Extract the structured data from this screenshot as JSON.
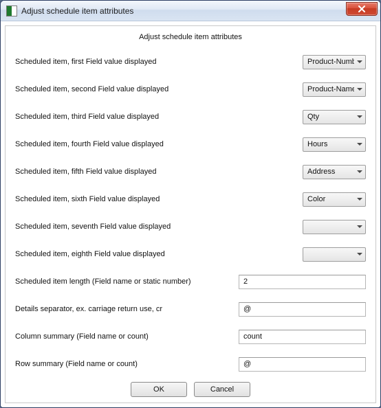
{
  "window": {
    "title": "Adjust schedule item attributes"
  },
  "form": {
    "heading": "Adjust schedule item attributes",
    "fields": {
      "f1": {
        "label": "Scheduled item, first Field value displayed",
        "value": "Product-Number"
      },
      "f2": {
        "label": "Scheduled item, second Field value displayed",
        "value": "Product-Name"
      },
      "f3": {
        "label": "Scheduled item, third Field value displayed",
        "value": "Qty"
      },
      "f4": {
        "label": "Scheduled item, fourth Field value displayed",
        "value": "Hours"
      },
      "f5": {
        "label": "Scheduled item, fifth Field value displayed",
        "value": "Address"
      },
      "f6": {
        "label": "Scheduled item, sixth Field value displayed",
        "value": "Color"
      },
      "f7": {
        "label": "Scheduled item, seventh Field value displayed",
        "value": ""
      },
      "f8": {
        "label": "Scheduled item, eighth Field value displayed",
        "value": ""
      },
      "len": {
        "label": "Scheduled item length (Field name or static number)",
        "value": "2"
      },
      "sep": {
        "label": "Details separator, ex. carriage return use, cr",
        "value": "@"
      },
      "col": {
        "label": "Column summary (Field name or count)",
        "value": "count"
      },
      "rowf": {
        "label": "Row summary (Field name or count)",
        "value": "@"
      }
    },
    "buttons": {
      "ok": "OK",
      "cancel": "Cancel"
    }
  }
}
